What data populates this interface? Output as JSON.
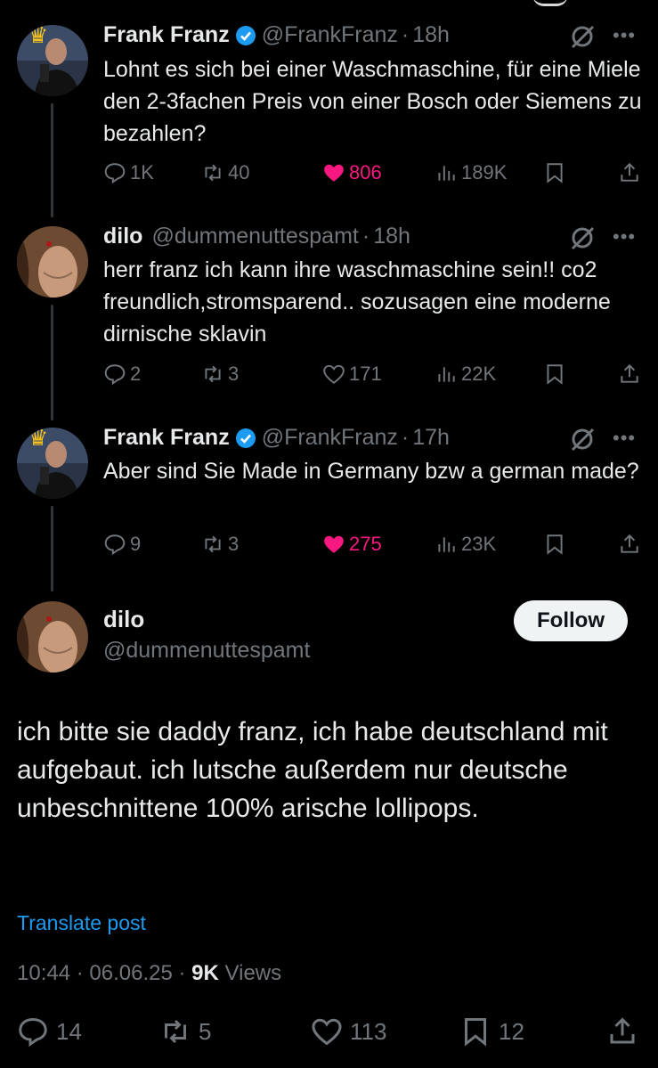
{
  "colors": {
    "background": "#000000",
    "text": "#e7e9ea",
    "muted": "#71767b",
    "like": "#f91880",
    "link": "#1d9bf0",
    "verified": "#1d9bf0"
  },
  "replies": [
    {
      "name": "Frank Franz",
      "verified": true,
      "handle": "@FrankFranz",
      "dot": "·",
      "time": "18h",
      "text": "Lohnt es sich bei einer Waschmaschine, für eine Miele den 2-3fachen Preis von einer Bosch oder Siemens zu bezahlen?",
      "replies": "1K",
      "reposts": "40",
      "likes": "806",
      "liked": true,
      "views": "189K",
      "avatar_icon": "crown-icon"
    },
    {
      "name": "dilo",
      "verified": false,
      "handle": "@dummenuttespamt",
      "dot": "·",
      "time": "18h",
      "text": "herr franz ich kann ihre waschmaschine sein!! co2 freundlich,stromsparend.. sozusagen eine moderne dirnische sklavin",
      "replies": "2",
      "reposts": "3",
      "likes": "171",
      "liked": false,
      "views": "22K"
    },
    {
      "name": "Frank Franz",
      "verified": true,
      "handle": "@FrankFranz",
      "dot": "·",
      "time": "17h",
      "text": "Aber sind Sie Made in Germany bzw a german made?",
      "replies": "9",
      "reposts": "3",
      "likes": "275",
      "liked": true,
      "views": "23K",
      "avatar_icon": "crown-icon"
    }
  ],
  "main_post": {
    "name": "dilo",
    "handle": "@dummenuttespamt",
    "follow_label": "Follow",
    "text": "ich bitte sie daddy franz, ich habe deutschland mit aufgebaut. ich lutsche außerdem nur deutsche unbeschnittene 100% arische lollipops.",
    "translate_label": "Translate post",
    "time": "10:44",
    "dot": "·",
    "date": "06.06.25",
    "views_count": "9K",
    "views_label": "Views",
    "replies": "14",
    "reposts": "5",
    "likes": "113",
    "bookmarks": "12"
  }
}
